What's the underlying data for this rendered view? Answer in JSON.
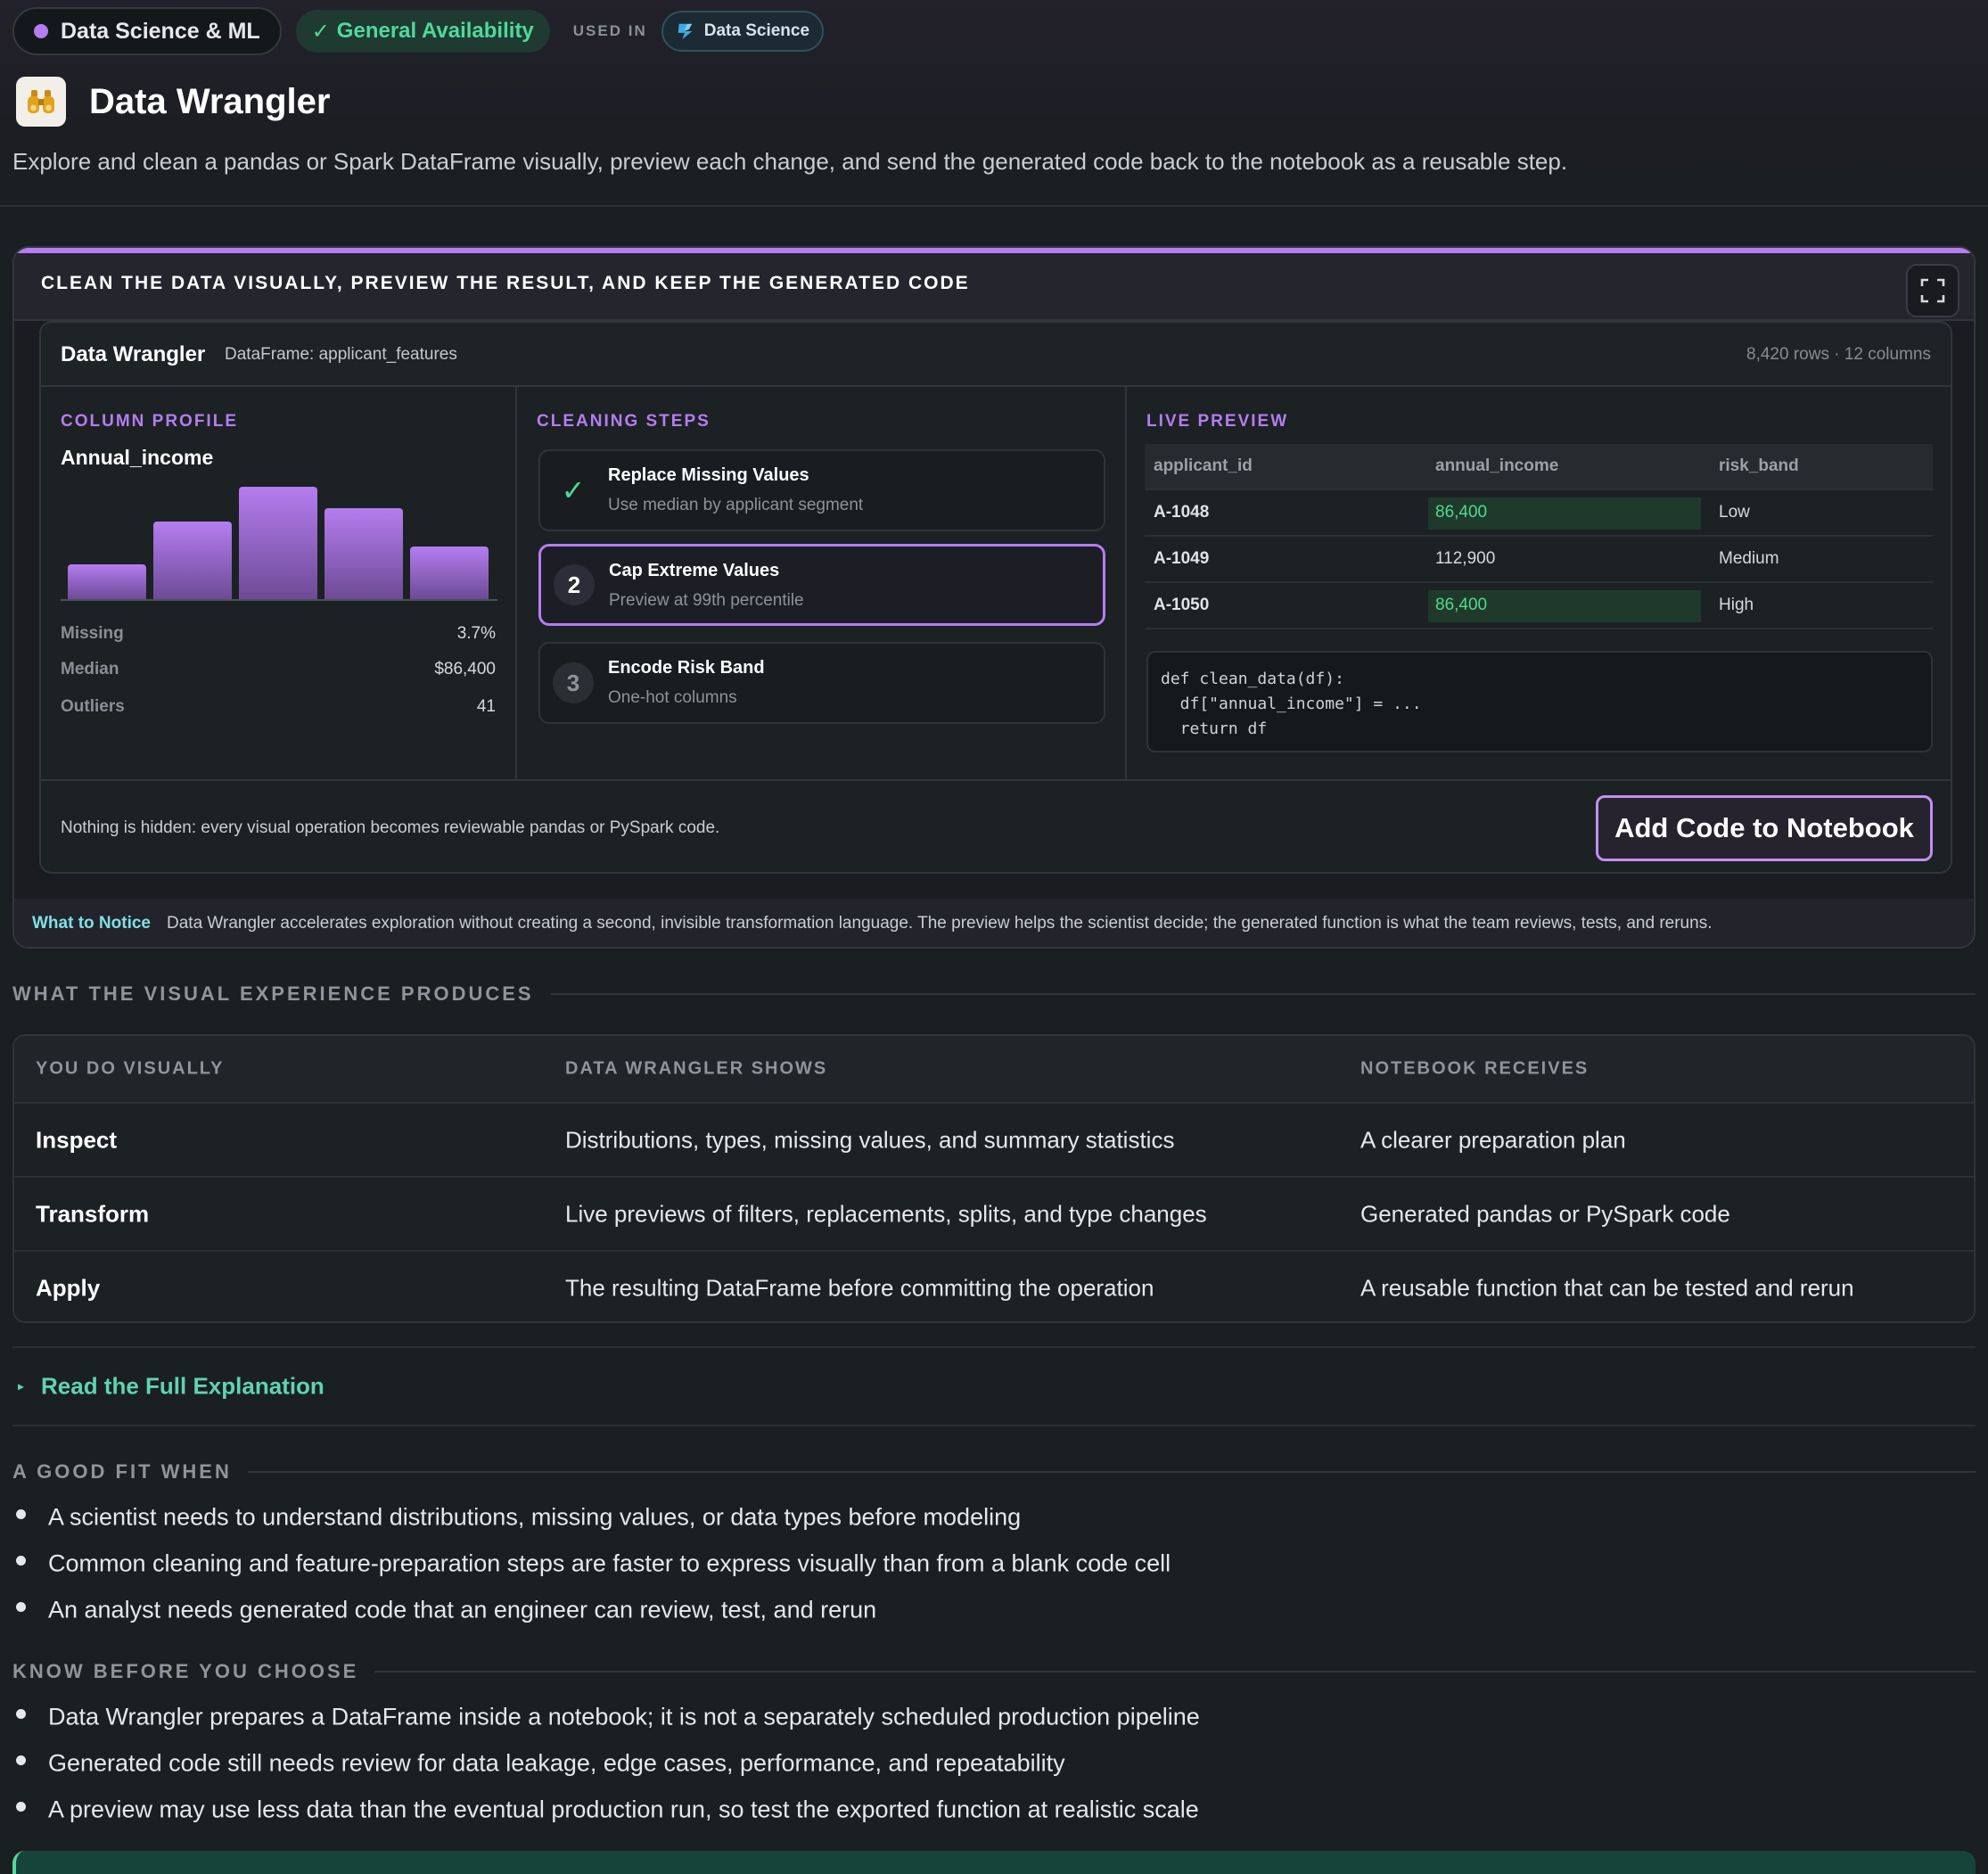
{
  "header": {
    "category": "Data Science & ML",
    "availability": "General Availability",
    "used_in_label": "USED IN",
    "used_in_product": "Data Science",
    "title": "Data Wrangler",
    "description": "Explore and clean a pandas or Spark DataFrame visually, preview each change, and send the generated code back to the notebook as a reusable step."
  },
  "demo": {
    "heading": "CLEAN THE DATA VISUALLY, PREVIEW THE RESULT, AND KEEP THE GENERATED CODE",
    "app_name": "Data Wrangler",
    "dataframe": "DataFrame: applicant_features",
    "meta": "8,420 rows · 12 columns",
    "profile": {
      "label": "COLUMN PROFILE",
      "column": "Annual_income",
      "histogram": [
        0.31,
        0.69,
        1.0,
        0.81,
        0.47
      ],
      "stats": [
        {
          "key": "Missing",
          "value": "3.7%"
        },
        {
          "key": "Median",
          "value": "$86,400"
        },
        {
          "key": "Outliers",
          "value": "41"
        }
      ]
    },
    "steps": {
      "label": "CLEANING STEPS",
      "items": [
        {
          "badge": "✓",
          "title": "Replace Missing Values",
          "sub": "Use median by applicant segment",
          "state": "done"
        },
        {
          "badge": "2",
          "title": "Cap Extreme Values",
          "sub": "Preview at 99th percentile",
          "state": "active"
        },
        {
          "badge": "3",
          "title": "Encode Risk Band",
          "sub": "One-hot columns",
          "state": "todo"
        }
      ]
    },
    "preview": {
      "label": "LIVE PREVIEW",
      "columns": [
        "applicant_id",
        "annual_income",
        "risk_band"
      ],
      "rows": [
        {
          "id": "A-1048",
          "income": "86,400",
          "band": "Low",
          "highlight": true
        },
        {
          "id": "A-1049",
          "income": "112,900",
          "band": "Medium",
          "highlight": false
        },
        {
          "id": "A-1050",
          "income": "86,400",
          "band": "High",
          "highlight": true
        }
      ],
      "code": "def clean_data(df):\n  df[\"annual_income\"] = ...\n  return df"
    },
    "footer_text": "Nothing is hidden: every visual operation becomes reviewable pandas or PySpark code.",
    "add_button": "Add Code to Notebook",
    "notice_key": "What to Notice",
    "notice_text": "Data Wrangler accelerates exploration without creating a second, invisible transformation language. The preview helps the scientist decide; the generated function is what the team reviews, tests, and reruns."
  },
  "produces": {
    "heading": "WHAT THE VISUAL EXPERIENCE PRODUCES",
    "columns": [
      "YOU DO VISUALLY",
      "DATA WRANGLER SHOWS",
      "NOTEBOOK RECEIVES"
    ],
    "rows": [
      [
        "Inspect",
        "Distributions, types, missing values, and summary statistics",
        "A clearer preparation plan"
      ],
      [
        "Transform",
        "Live previews of filters, replacements, splits, and type changes",
        "Generated pandas or PySpark code"
      ],
      [
        "Apply",
        "The resulting DataFrame before committing the operation",
        "A reusable function that can be tested and rerun"
      ]
    ]
  },
  "read_more": "Read the Full Explanation",
  "good_fit": {
    "heading": "A GOOD FIT WHEN",
    "items": [
      "A scientist needs to understand distributions, missing values, or data types before modeling",
      "Common cleaning and feature-preparation steps are faster to express visually than from a blank code cell",
      "An analyst needs generated code that an engineer can review, test, and rerun"
    ]
  },
  "know_before": {
    "heading": "KNOW BEFORE YOU CHOOSE",
    "items": [
      "Data Wrangler prepares a DataFrame inside a notebook; it is not a separately scheduled production pipeline",
      "Generated code still needs review for data leakage, edge cases, performance, and repeatability",
      "A preview may use less data than the eventual production run, so test the exported function at realistic scale"
    ]
  },
  "colors": {
    "accent": "#b57df0",
    "success": "#4fd99a",
    "link": "#5fd3b0"
  }
}
